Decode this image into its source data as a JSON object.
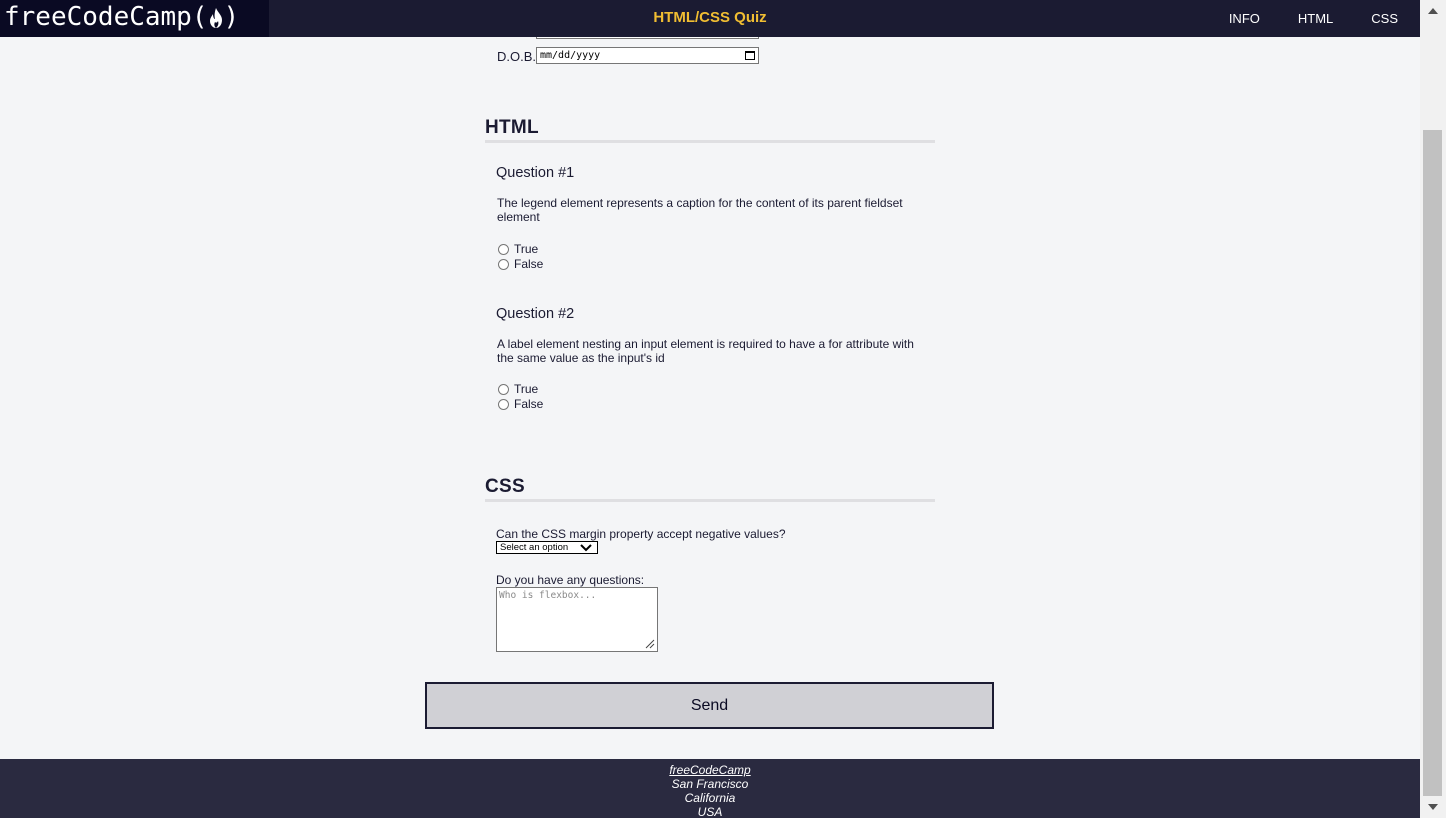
{
  "header": {
    "logo": "freeCodeCamp(",
    "logo_end": ")",
    "title": "HTML/CSS Quiz",
    "nav": [
      "INFO",
      "HTML",
      "CSS"
    ]
  },
  "form": {
    "dob_label": "D.O.B.",
    "dob_value": "mm/dd/yyyy"
  },
  "html_section": {
    "heading": "HTML",
    "questions": [
      {
        "title": "Question #1",
        "text": "The legend element represents a caption for the content of its parent fieldset element",
        "options": [
          "True",
          "False"
        ]
      },
      {
        "title": "Question #2",
        "text": "A label element nesting an input element is required to have a for attribute with the same value as the input's id",
        "options": [
          "True",
          "False"
        ]
      }
    ]
  },
  "css_section": {
    "heading": "CSS",
    "question": "Can the CSS margin property accept negative values?",
    "select_value": "Select an option",
    "textarea_label": "Do you have any questions:",
    "textarea_placeholder": "Who is flexbox..."
  },
  "send_label": "Send",
  "footer": {
    "link": "freeCodeCamp",
    "lines": [
      "San Francisco",
      "California",
      "USA"
    ]
  },
  "icons": {
    "logo_flame": "flame-icon",
    "calendar": "calendar-icon",
    "select_chevron": "chevron-down-icon",
    "resize": "resize-grip-icon"
  },
  "colors": {
    "header_bg": "#1b1b32",
    "title": "#f1be32",
    "page_bg": "#f4f5f7",
    "button_bg": "#d0d0d5",
    "footer_bg": "#2a2a40"
  }
}
